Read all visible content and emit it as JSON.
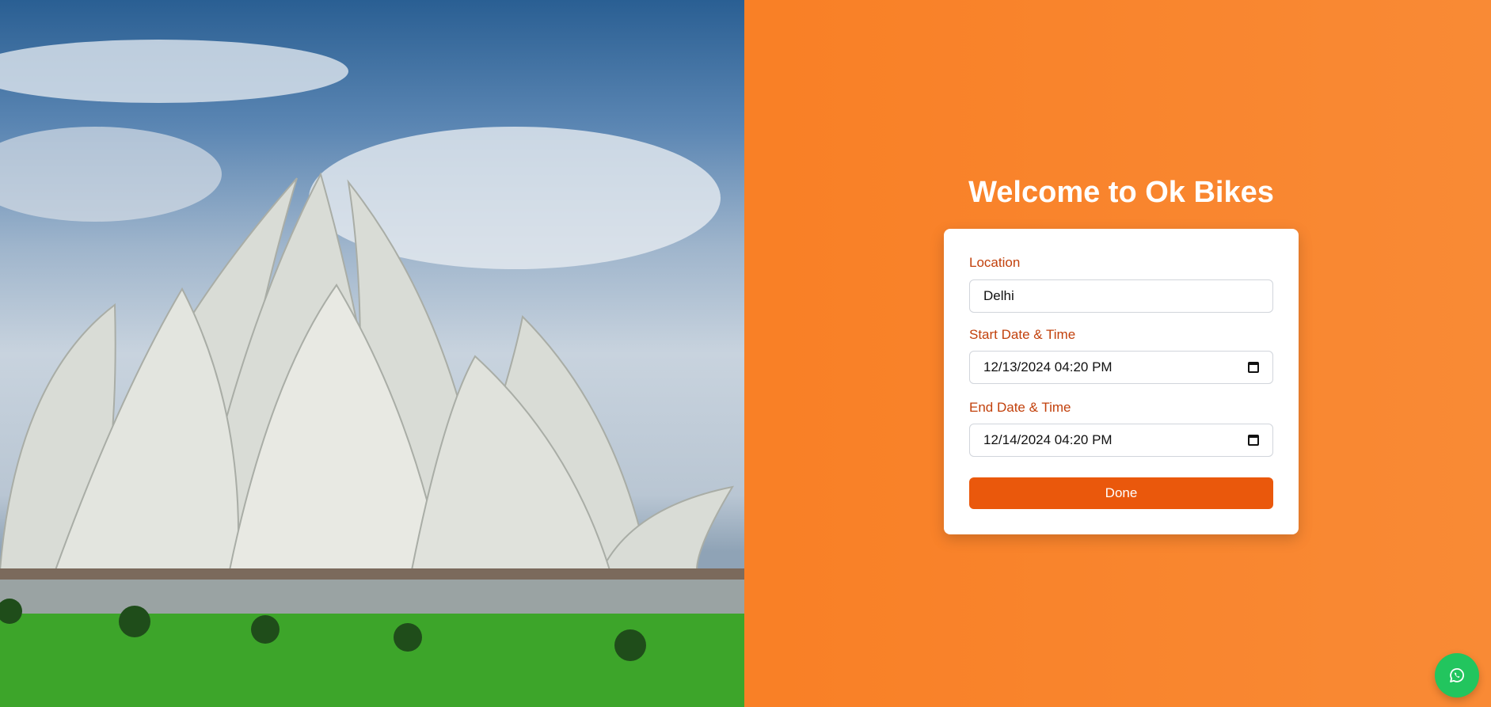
{
  "title": "Welcome to Ok Bikes",
  "form": {
    "location": {
      "label": "Location",
      "value": "Delhi"
    },
    "start": {
      "label": "Start Date & Time",
      "value": "12/13/2024 04:20 PM"
    },
    "end": {
      "label": "End Date & Time",
      "value": "12/14/2024 04:20 PM"
    },
    "submit_label": "Done"
  },
  "colors": {
    "accent": "#ea580c",
    "label": "#c2410c",
    "whatsapp": "#22c55e"
  }
}
